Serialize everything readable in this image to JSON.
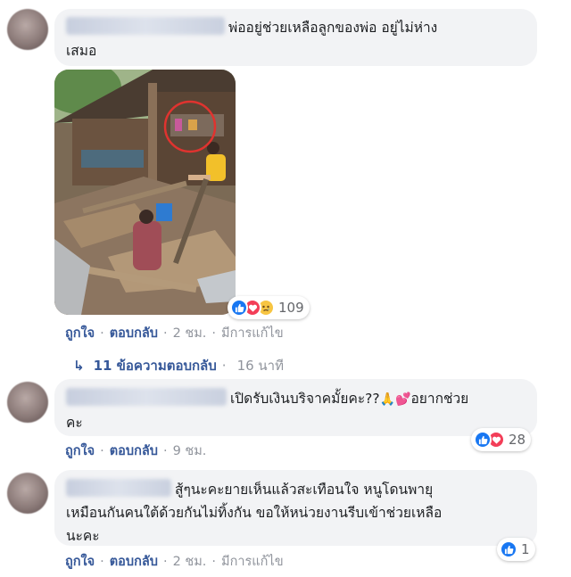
{
  "comments": [
    {
      "text": "พ่ออยู่ช่วยเหลือลูกของพ่อ อยู่ไม่ห่างเสมอ",
      "line1": "พ่ออยู่ช่วยเหลือลูกของพ่อ อยู่ไม่ห่าง",
      "line2": "เสมอ",
      "reaction_count": "109",
      "reactions": [
        "like-icon",
        "love-icon",
        "sad-icon"
      ],
      "actions": {
        "like": "ถูกใจ",
        "reply": "ตอบกลับ",
        "time": "2 ชม.",
        "edited": "มีการแก้ไข"
      },
      "replies": {
        "label": "11 ข้อความตอบกลับ",
        "time": "16 นาที"
      }
    },
    {
      "line1": "เปิดรับเงินบริจาคมั้ยคะ??",
      "line1_tail": "อยากช่วย",
      "line2": "คะ",
      "emojis": [
        "pray-emoji",
        "heart-emoji"
      ],
      "reaction_count": "28",
      "reactions": [
        "like-icon",
        "love-icon"
      ],
      "actions": {
        "like": "ถูกใจ",
        "reply": "ตอบกลับ",
        "time": "9 ชม."
      }
    },
    {
      "line1": "สู้ๆนะคะยายเห็นแล้วสะเทือนใจ หนูโดนพายุ",
      "line2": "เหมือนกันคนใต้ด้วยกันไม่ทิ้งกัน ขอให้หน่วยงานรีบเข้าช่วยเหลือ",
      "line3": "นะคะ",
      "reaction_count": "1",
      "reactions": [
        "like-icon"
      ],
      "actions": {
        "like": "ถูกใจ",
        "reply": "ตอบกลับ",
        "time": "2 ชม.",
        "edited": "มีการแก้ไข"
      }
    }
  ],
  "colors": {
    "link": "#365899",
    "meta": "#90949c",
    "bubble": "#f2f3f5",
    "like": "#1877f2",
    "love": "#f33e58",
    "highlight_circle": "#e0332f"
  }
}
